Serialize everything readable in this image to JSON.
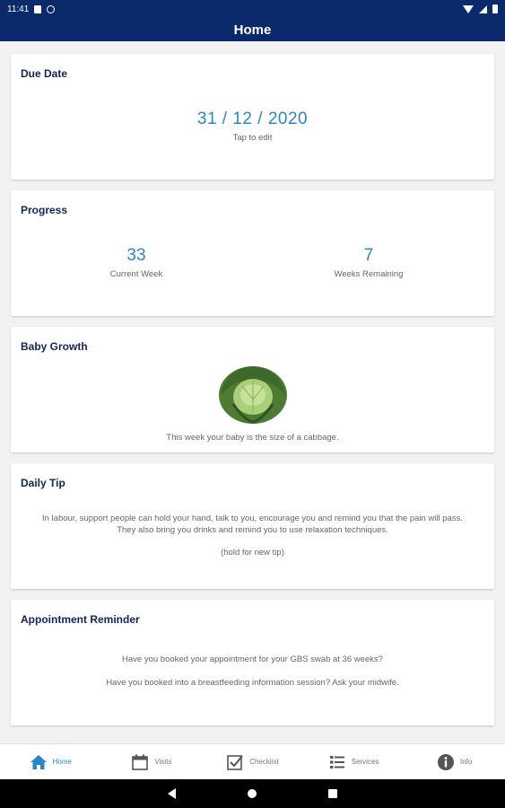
{
  "status_bar": {
    "time": "11:41"
  },
  "app_bar": {
    "title": "Home"
  },
  "due_date": {
    "title": "Due Date",
    "value": "31 / 12 / 2020",
    "hint": "Tap to edit"
  },
  "progress": {
    "title": "Progress",
    "current_week": {
      "value": "33",
      "label": "Current Week"
    },
    "weeks_remaining": {
      "value": "7",
      "label": "Weeks Remaining"
    }
  },
  "baby_growth": {
    "title": "Baby Growth",
    "image_icon": "cabbage-image",
    "caption": "This week your baby is the size of a cabbage."
  },
  "daily_tip": {
    "title": "Daily Tip",
    "line1": "In labour, support people can hold your hand, talk to you, encourage you and remind you that the pain will pass.",
    "line2": "They also bring you drinks and remind you to use relaxation techniques.",
    "hint": "(hold for new tip)"
  },
  "appointment": {
    "title": "Appointment Reminder",
    "line1": "Have you booked your appointment for your GBS swab at 36 weeks?",
    "line2": "Have you booked into a breastfeeding information session? Ask your midwife."
  },
  "bottom_nav": {
    "items": [
      {
        "label": "Home",
        "icon": "house-icon",
        "active": true
      },
      {
        "label": "Visits",
        "icon": "calendar-icon"
      },
      {
        "label": "Checklist",
        "icon": "checkbox-icon"
      },
      {
        "label": "Services",
        "icon": "list-icon"
      },
      {
        "label": "Info",
        "icon": "info-icon"
      }
    ]
  },
  "colors": {
    "primary": "#0b2a6b",
    "accent": "#2b86c5",
    "title": "#14235a",
    "background": "#f2f2f2"
  }
}
